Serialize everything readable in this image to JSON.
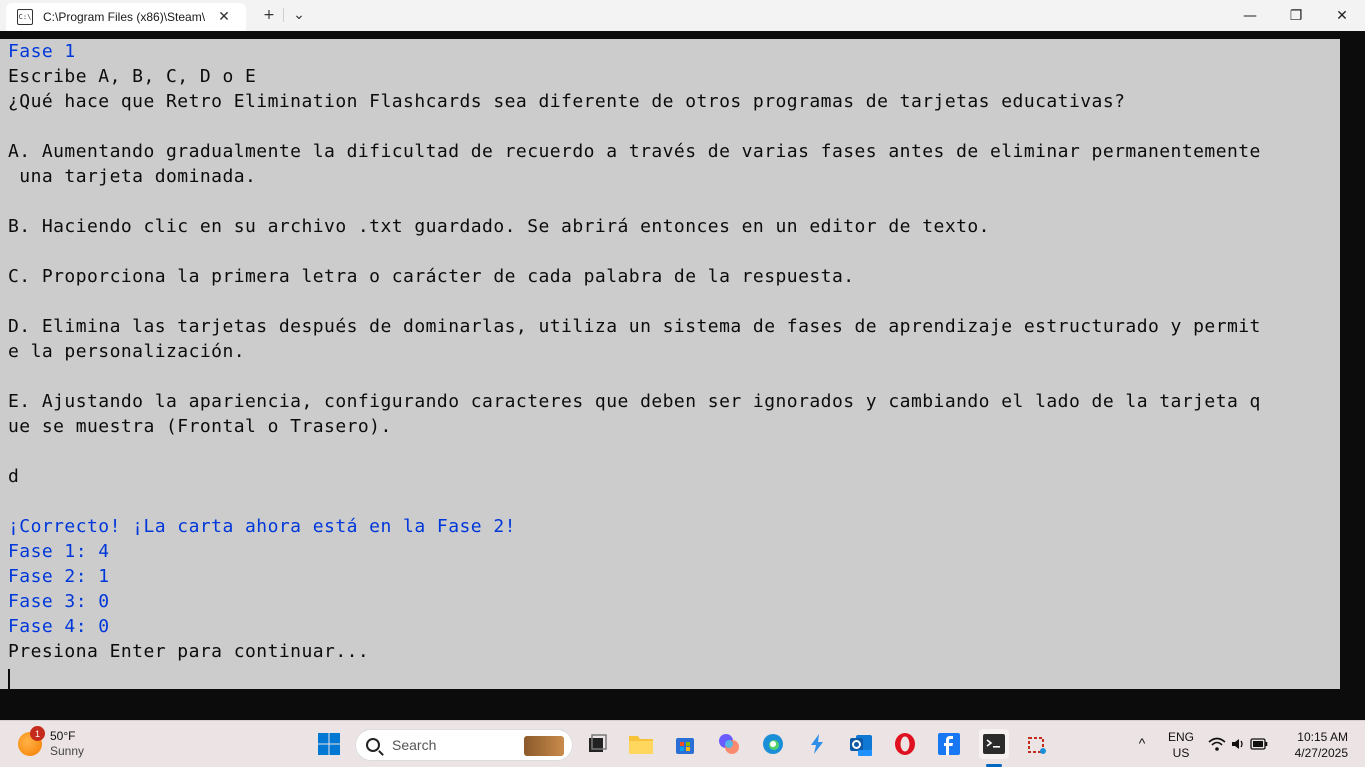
{
  "window": {
    "tab_title": "C:\\Program Files (x86)\\Steam\\",
    "tab_icon_text": "C:\\",
    "close_tab_glyph": "✕",
    "new_tab_glyph": "+",
    "dropdown_glyph": "⌄",
    "minimize_glyph": "—",
    "maximize_glyph": "❐",
    "close_glyph": "✕"
  },
  "console": {
    "lines": [
      {
        "text": "Fase 1",
        "color": "blue"
      },
      {
        "text": "Escribe A, B, C, D o E",
        "color": "dark"
      },
      {
        "text": "¿Qué hace que Retro Elimination Flashcards sea diferente de otros programas de tarjetas educativas?",
        "color": "dark"
      },
      {
        "text": "",
        "color": "dark"
      },
      {
        "text": "A. Aumentando gradualmente la dificultad de recuerdo a través de varias fases antes de eliminar permanentemente",
        "color": "dark"
      },
      {
        "text": " una tarjeta dominada.",
        "color": "dark"
      },
      {
        "text": "",
        "color": "dark"
      },
      {
        "text": "B. Haciendo clic en su archivo .txt guardado. Se abrirá entonces en un editor de texto.",
        "color": "dark"
      },
      {
        "text": "",
        "color": "dark"
      },
      {
        "text": "C. Proporciona la primera letra o carácter de cada palabra de la respuesta.",
        "color": "dark"
      },
      {
        "text": "",
        "color": "dark"
      },
      {
        "text": "D. Elimina las tarjetas después de dominarlas, utiliza un sistema de fases de aprendizaje estructurado y permit",
        "color": "dark"
      },
      {
        "text": "e la personalización.",
        "color": "dark"
      },
      {
        "text": "",
        "color": "dark"
      },
      {
        "text": "E. Ajustando la apariencia, configurando caracteres que deben ser ignorados y cambiando el lado de la tarjeta q",
        "color": "dark"
      },
      {
        "text": "ue se muestra (Frontal o Trasero).",
        "color": "dark"
      },
      {
        "text": "",
        "color": "dark"
      },
      {
        "text": "d",
        "color": "dark"
      },
      {
        "text": "",
        "color": "dark"
      },
      {
        "text": "¡Correcto! ¡La carta ahora está en la Fase 2!",
        "color": "blue"
      },
      {
        "text": "Fase 1: 4",
        "color": "blue"
      },
      {
        "text": "Fase 2: 1",
        "color": "blue"
      },
      {
        "text": "Fase 3: 0",
        "color": "blue"
      },
      {
        "text": "Fase 4: 0",
        "color": "blue"
      },
      {
        "text": "Presiona Enter para continuar...",
        "color": "dark"
      }
    ]
  },
  "taskbar": {
    "weather_badge": "1",
    "weather_temp": "50°F",
    "weather_desc": "Sunny",
    "search_placeholder": "Search",
    "language": "ENG",
    "region": "US",
    "time": "10:15 AM",
    "date": "4/27/2025",
    "tray_chevron": "^"
  },
  "colors": {
    "console_bg": "#cccccc",
    "console_text": "#0c0c0c",
    "console_blue": "#0037da",
    "taskbar_bg": "#ece4e4"
  }
}
